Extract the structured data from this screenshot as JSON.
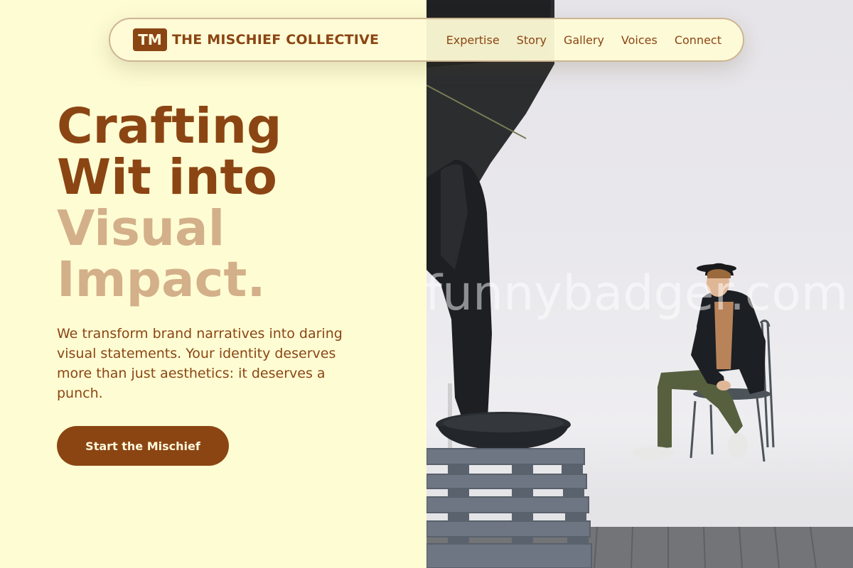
{
  "brand": {
    "badge": "TM",
    "name": "THE MISCHIEF COLLECTIVE"
  },
  "nav": {
    "items": [
      {
        "label": "Expertise"
      },
      {
        "label": "Story"
      },
      {
        "label": "Gallery"
      },
      {
        "label": "Voices"
      },
      {
        "label": "Connect"
      }
    ]
  },
  "hero": {
    "title_dark_1": "Crafting",
    "title_dark_2": "Wit into",
    "title_light_1": "Visual",
    "title_light_2": "Impact.",
    "description": "We transform brand narratives into daring visual statements. Your identity deserves more than just aesthetics: it deserves a punch.",
    "cta_label": "Start the Mischief"
  },
  "image": {
    "watermark": "funnybadger.com"
  },
  "colors": {
    "background": "#fefcd3",
    "primary": "#8b4513",
    "accent_light": "#d3b08a"
  }
}
